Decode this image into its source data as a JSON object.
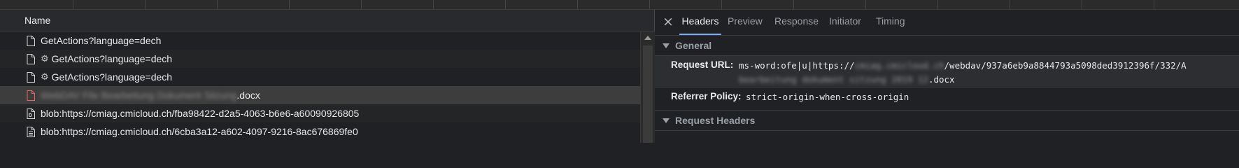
{
  "network_list": {
    "column_name": "Name",
    "rows": [
      {
        "icon": "document-icon",
        "gear": "",
        "text": "GetActions?language=dech",
        "blurred": ""
      },
      {
        "icon": "document-icon",
        "gear": "⚙",
        "text": "GetActions?language=dech",
        "blurred": ""
      },
      {
        "icon": "document-icon",
        "gear": "⚙",
        "text": "GetActions?language=dech",
        "blurred": ""
      },
      {
        "icon": "document-error-icon",
        "gear": "",
        "text": ".docx",
        "blurred": "WebDAV File Bearbeitung Dokument Sitzung"
      },
      {
        "icon": "blob-document-icon",
        "gear": "",
        "text": "blob:https://cmiag.cmicloud.ch/fba98422-d2a5-4063-b6e6-a60090926805",
        "blurred": ""
      },
      {
        "icon": "blob-document-icon",
        "gear": "",
        "text": "blob:https://cmiag.cmicloud.ch/6cba3a12-a602-4097-9216-8ac676869fe0",
        "blurred": ""
      }
    ]
  },
  "details": {
    "close_glyph": "×",
    "tabs": [
      "Headers",
      "Preview",
      "Response",
      "Initiator",
      "Timing"
    ],
    "active_tab": "Headers",
    "general": {
      "title": "General",
      "request_url_key": "Request URL:",
      "request_url_prefix": "ms-word:ofe|u|https://",
      "request_url_blur1": "cmiag.cmicloud.ch",
      "request_url_suffix": "/webdav/937a6eb9a8844793a5098ded3912396f/332/A",
      "request_url_blur2": "bearbeitung dokument sitzung 2019 12",
      "request_url_end": ".docx",
      "referrer_policy_key": "Referrer Policy:",
      "referrer_policy_value": "strict-origin-when-cross-origin"
    },
    "request_headers_title": "Request Headers"
  },
  "colors": {
    "accent": "#7cacf8",
    "error": "#e46962"
  }
}
